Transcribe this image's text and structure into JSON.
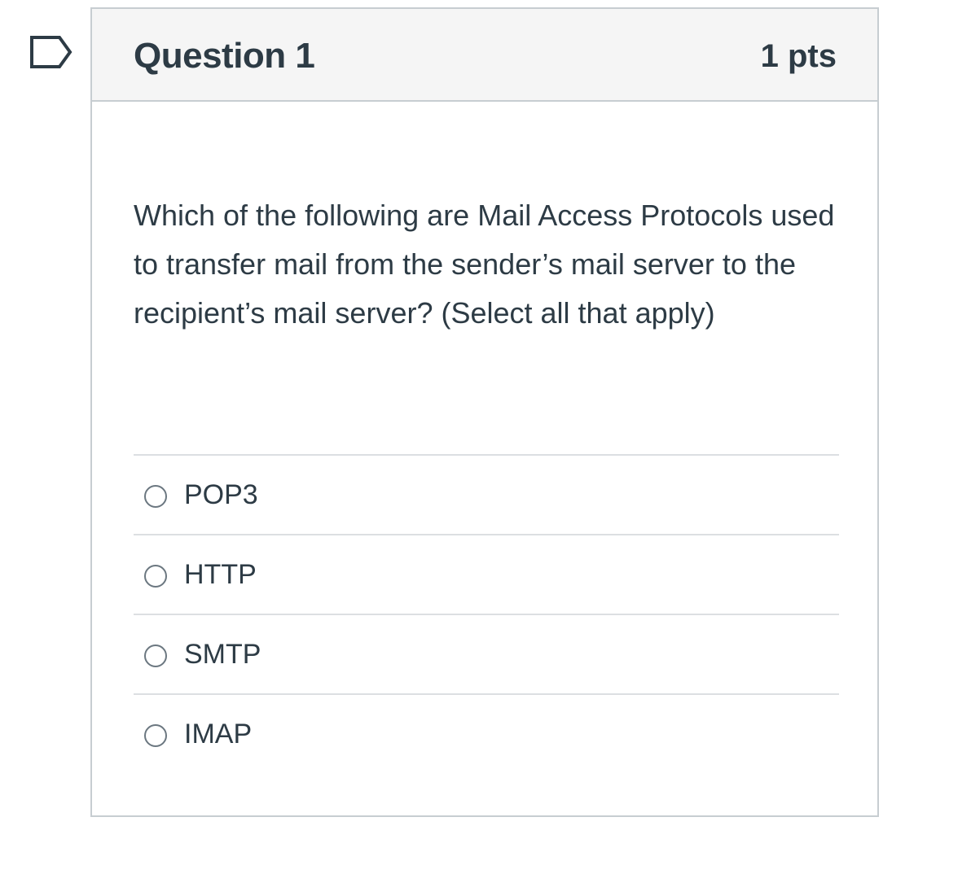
{
  "question": {
    "title": "Question 1",
    "points": "1 pts",
    "text": "Which of the following are Mail Access Protocols used to transfer mail from the sender’s mail server to the recipient’s mail server? (Select all that apply)",
    "flag_icon": "flag-question-icon",
    "answers": [
      {
        "label": "POP3",
        "selected": false
      },
      {
        "label": "HTTP",
        "selected": false
      },
      {
        "label": "SMTP",
        "selected": false
      },
      {
        "label": "IMAP",
        "selected": false
      }
    ]
  },
  "colors": {
    "text": "#2d3b45",
    "border": "#c7cdd1",
    "header_bg": "#f5f5f5",
    "divider": "#dcdfe2",
    "flag": "#2d3b45"
  }
}
